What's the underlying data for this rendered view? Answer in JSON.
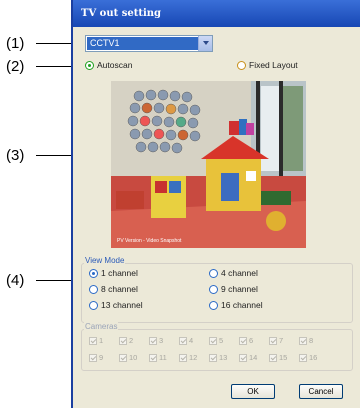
{
  "callouts": [
    "(1)",
    "(2)",
    "(3)",
    "(4)"
  ],
  "dialog": {
    "title": "TV out setting",
    "source_select": {
      "value": "CCTV1"
    },
    "layout_options": [
      {
        "label": "Autoscan",
        "selected": true
      },
      {
        "label": "Fixed Layout",
        "selected": false
      }
    ],
    "preview": {
      "timestamp": "PV Version - Video Snapshot"
    },
    "view_mode": {
      "label": "View Mode",
      "options": [
        {
          "label": "1 channel",
          "selected": true
        },
        {
          "label": "4 channel",
          "selected": false
        },
        {
          "label": "8 channel",
          "selected": false
        },
        {
          "label": "9 channel",
          "selected": false
        },
        {
          "label": "13 channel",
          "selected": false
        },
        {
          "label": "16 channel",
          "selected": false
        }
      ]
    },
    "cameras": {
      "label": "Cameras",
      "items": [
        "1",
        "2",
        "3",
        "4",
        "5",
        "6",
        "7",
        "8",
        "9",
        "10",
        "11",
        "12",
        "13",
        "14",
        "15",
        "16"
      ]
    },
    "buttons": {
      "ok": "OK",
      "cancel": "Cancel"
    }
  }
}
